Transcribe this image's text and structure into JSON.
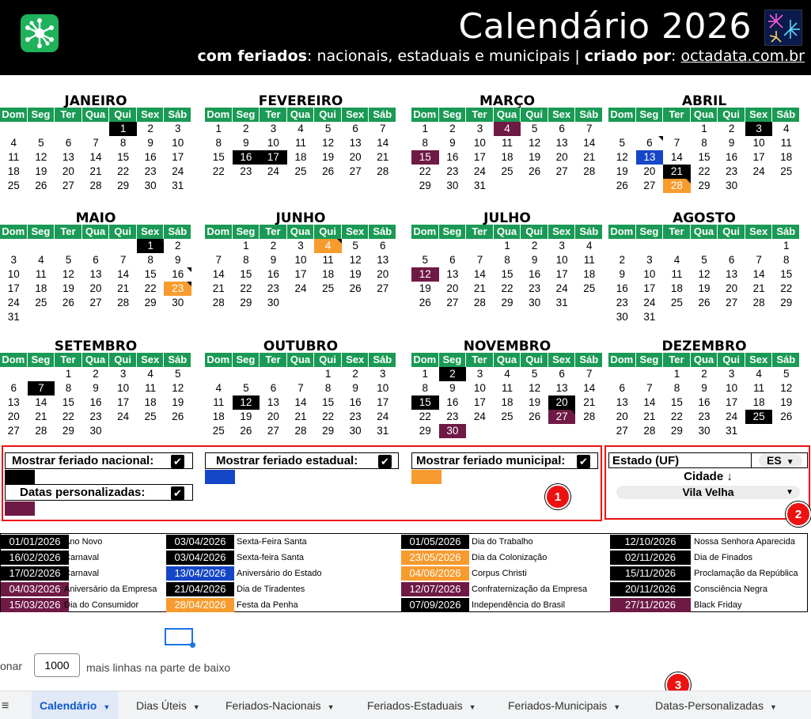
{
  "header": {
    "title": "Calendário 2026",
    "subtitle_bold1": "com feriados",
    "subtitle_text1": ": nacionais, estaduais e municipais | ",
    "subtitle_bold2": "criado por",
    "subtitle_text2": ": ",
    "subtitle_link": "octadata.com.br"
  },
  "weekdays": [
    "Dom",
    "Seg",
    "Ter",
    "Qua",
    "Qui",
    "Sex",
    "Sáb"
  ],
  "months": [
    {
      "name": "JANEIRO",
      "weeks": [
        [
          "",
          "",
          "",
          "",
          1,
          2,
          3
        ],
        [
          4,
          5,
          6,
          7,
          8,
          9,
          10
        ],
        [
          11,
          12,
          13,
          14,
          15,
          16,
          17
        ],
        [
          18,
          19,
          20,
          21,
          22,
          23,
          24
        ],
        [
          25,
          26,
          27,
          28,
          29,
          30,
          31
        ]
      ],
      "marks": {
        "1": "nat"
      }
    },
    {
      "name": "FEVEREIRO",
      "weeks": [
        [
          1,
          2,
          3,
          4,
          5,
          6,
          7
        ],
        [
          8,
          9,
          10,
          11,
          12,
          13,
          14
        ],
        [
          15,
          16,
          17,
          18,
          19,
          20,
          21
        ],
        [
          22,
          23,
          24,
          25,
          26,
          27,
          28
        ]
      ],
      "marks": {
        "16": "nat",
        "17": "nat"
      }
    },
    {
      "name": "MARÇO",
      "weeks": [
        [
          1,
          2,
          3,
          4,
          5,
          6,
          7
        ],
        [
          8,
          9,
          10,
          11,
          12,
          13,
          14
        ],
        [
          15,
          16,
          17,
          18,
          19,
          20,
          21
        ],
        [
          22,
          23,
          24,
          25,
          26,
          27,
          28
        ],
        [
          29,
          30,
          31,
          "",
          "",
          "",
          ""
        ]
      ],
      "marks": {
        "4": "cus",
        "15": "cus"
      }
    },
    {
      "name": "ABRIL",
      "weeks": [
        [
          "",
          "",
          "",
          1,
          2,
          3,
          4
        ],
        [
          5,
          6,
          7,
          8,
          9,
          10,
          11
        ],
        [
          12,
          13,
          14,
          15,
          16,
          17,
          18
        ],
        [
          19,
          20,
          21,
          22,
          23,
          24,
          25
        ],
        [
          26,
          27,
          28,
          29,
          30,
          "",
          ""
        ]
      ],
      "marks": {
        "3": "nat",
        "13": "est",
        "21": "nat",
        "28": "mun"
      },
      "corner": [
        "6",
        "21",
        "28"
      ]
    },
    {
      "name": "MAIO",
      "weeks": [
        [
          "",
          "",
          "",
          "",
          "",
          1,
          2
        ],
        [
          3,
          4,
          5,
          6,
          7,
          8,
          9
        ],
        [
          10,
          11,
          12,
          13,
          14,
          15,
          16
        ],
        [
          17,
          18,
          19,
          20,
          21,
          22,
          23
        ],
        [
          24,
          25,
          26,
          27,
          28,
          29,
          30
        ],
        [
          31,
          "",
          "",
          "",
          "",
          "",
          ""
        ]
      ],
      "marks": {
        "1": "nat",
        "23": "mun"
      },
      "corner": [
        "1",
        "16",
        "23"
      ]
    },
    {
      "name": "JUNHO",
      "weeks": [
        [
          "",
          1,
          2,
          3,
          4,
          5,
          6
        ],
        [
          7,
          8,
          9,
          10,
          11,
          12,
          13
        ],
        [
          14,
          15,
          16,
          17,
          18,
          19,
          20
        ],
        [
          21,
          22,
          23,
          24,
          25,
          26,
          27
        ],
        [
          28,
          29,
          30,
          "",
          "",
          "",
          ""
        ]
      ],
      "marks": {
        "4": "mun"
      },
      "corner": [
        "4"
      ]
    },
    {
      "name": "JULHO",
      "weeks": [
        [
          "",
          "",
          "",
          1,
          2,
          3,
          4
        ],
        [
          5,
          6,
          7,
          8,
          9,
          10,
          11
        ],
        [
          12,
          13,
          14,
          15,
          16,
          17,
          18
        ],
        [
          19,
          20,
          21,
          22,
          23,
          24,
          25
        ],
        [
          26,
          27,
          28,
          29,
          30,
          31,
          ""
        ]
      ],
      "marks": {
        "12": "cus"
      }
    },
    {
      "name": "AGOSTO",
      "weeks": [
        [
          "",
          "",
          "",
          "",
          "",
          "",
          1
        ],
        [
          2,
          3,
          4,
          5,
          6,
          7,
          8
        ],
        [
          9,
          10,
          11,
          12,
          13,
          14,
          15
        ],
        [
          16,
          17,
          18,
          19,
          20,
          21,
          22
        ],
        [
          23,
          24,
          25,
          26,
          27,
          28,
          29
        ],
        [
          30,
          31,
          "",
          "",
          "",
          "",
          ""
        ]
      ],
      "marks": {}
    },
    {
      "name": "SETEMBRO",
      "weeks": [
        [
          "",
          "",
          1,
          2,
          3,
          4,
          5
        ],
        [
          6,
          7,
          8,
          9,
          10,
          11,
          12
        ],
        [
          13,
          14,
          15,
          16,
          17,
          18,
          19
        ],
        [
          20,
          21,
          22,
          23,
          24,
          25,
          26
        ],
        [
          27,
          28,
          29,
          30,
          "",
          "",
          ""
        ]
      ],
      "marks": {
        "7": "nat"
      }
    },
    {
      "name": "OUTUBRO",
      "weeks": [
        [
          "",
          "",
          "",
          "",
          1,
          2,
          3
        ],
        [
          4,
          5,
          6,
          7,
          8,
          9,
          10
        ],
        [
          11,
          12,
          13,
          14,
          15,
          16,
          17
        ],
        [
          18,
          19,
          20,
          21,
          22,
          23,
          24
        ],
        [
          25,
          26,
          27,
          28,
          29,
          30,
          31
        ]
      ],
      "marks": {
        "12": "nat"
      }
    },
    {
      "name": "NOVEMBRO",
      "weeks": [
        [
          1,
          2,
          3,
          4,
          5,
          6,
          7
        ],
        [
          8,
          9,
          10,
          11,
          12,
          13,
          14
        ],
        [
          15,
          16,
          17,
          18,
          19,
          20,
          21
        ],
        [
          22,
          23,
          24,
          25,
          26,
          27,
          28
        ],
        [
          29,
          30,
          "",
          "",
          "",
          "",
          ""
        ]
      ],
      "marks": {
        "2": "nat",
        "15": "nat",
        "20": "nat",
        "27": "cus",
        "30": "cus"
      },
      "corner": [
        "27"
      ]
    },
    {
      "name": "DEZEMBRO",
      "weeks": [
        [
          "",
          "",
          1,
          2,
          3,
          4,
          5
        ],
        [
          6,
          7,
          8,
          9,
          10,
          11,
          12
        ],
        [
          13,
          14,
          15,
          16,
          17,
          18,
          19
        ],
        [
          20,
          21,
          22,
          23,
          24,
          25,
          26
        ],
        [
          27,
          28,
          29,
          30,
          31,
          "",
          ""
        ]
      ],
      "marks": {
        "25": "nat"
      }
    }
  ],
  "options": {
    "national_label": "Mostrar feriado nacional:",
    "state_label": "Mostrar feriado estadual:",
    "municipal_label": "Mostrar feriado municipal:",
    "custom_label": "Datas personalizadas:",
    "check": "✔",
    "badge1": "1",
    "badge2": "2",
    "badge3": "3"
  },
  "location": {
    "state_label": "Estado (UF)",
    "state_value": "ES",
    "city_label": "Cidade ↓",
    "city_value": "Vila Velha",
    "caret": "▼"
  },
  "colors": {
    "nat": "#000000",
    "est": "#1546c8",
    "mun": "#f89b2e",
    "cus": "#6e1a44",
    "header_green": "#1a9a55"
  },
  "holidays": [
    [
      {
        "date": "01/01/2026",
        "name": "Ano Novo",
        "type": "nat"
      },
      {
        "date": "16/02/2026",
        "name": "Carnaval",
        "type": "nat"
      },
      {
        "date": "17/02/2026",
        "name": "Carnaval",
        "type": "nat"
      },
      {
        "date": "04/03/2026",
        "name": "Aniversário da Empresa",
        "type": "cus"
      },
      {
        "date": "15/03/2026",
        "name": "Dia do Consumidor",
        "type": "cus"
      }
    ],
    [
      {
        "date": "03/04/2026",
        "name": "Sexta-Feira Santa",
        "type": "nat"
      },
      {
        "date": "03/04/2026",
        "name": "Sexta-feira Santa",
        "type": "nat"
      },
      {
        "date": "13/04/2026",
        "name": "Aniversário do Estado",
        "type": "est"
      },
      {
        "date": "21/04/2026",
        "name": "Dia de Tiradentes",
        "type": "nat"
      },
      {
        "date": "28/04/2026",
        "name": "Festa da Penha",
        "type": "mun"
      }
    ],
    [
      {
        "date": "01/05/2026",
        "name": "Dia do Trabalho",
        "type": "nat"
      },
      {
        "date": "23/05/2026",
        "name": "Dia da Colonização",
        "type": "mun"
      },
      {
        "date": "04/06/2026",
        "name": "Corpus Christi",
        "type": "mun"
      },
      {
        "date": "12/07/2026",
        "name": "Confraternização da Empresa",
        "type": "cus"
      },
      {
        "date": "07/09/2026",
        "name": "Independência do Brasil",
        "type": "nat"
      }
    ],
    [
      {
        "date": "12/10/2026",
        "name": "Nossa Senhora Aparecida",
        "type": "nat"
      },
      {
        "date": "02/11/2026",
        "name": "Dia de Finados",
        "type": "nat"
      },
      {
        "date": "15/11/2026",
        "name": "Proclamação da República",
        "type": "nat"
      },
      {
        "date": "20/11/2026",
        "name": "Consciência Negra",
        "type": "nat"
      },
      {
        "date": "27/11/2026",
        "name": "Black Friday",
        "type": "cus"
      }
    ]
  ],
  "add_rows": {
    "prefix": "onar",
    "value": "1000",
    "suffix": "mais linhas na parte de baixo"
  },
  "tabs": [
    {
      "label": "Calendário",
      "active": true
    },
    {
      "label": "Dias Úteis",
      "active": false
    },
    {
      "label": "Feriados-Nacionais",
      "active": false
    },
    {
      "label": "Feriados-Estaduais",
      "active": false
    },
    {
      "label": "Feriados-Municipais",
      "active": false
    },
    {
      "label": "Datas-Personalizadas",
      "active": false
    }
  ],
  "tab_caret": "▼",
  "menu_icon": "≡"
}
